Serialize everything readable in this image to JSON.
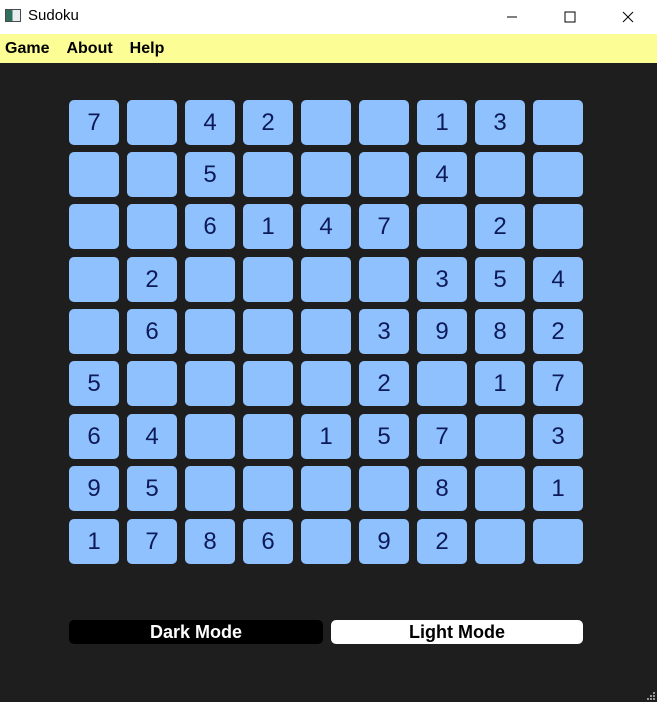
{
  "window": {
    "title": "Sudoku"
  },
  "menu": {
    "items": [
      "Game",
      "About",
      "Help"
    ]
  },
  "board": {
    "rows": [
      [
        "7",
        "",
        "4",
        "2",
        "",
        "",
        "1",
        "3",
        ""
      ],
      [
        "",
        "",
        "5",
        "",
        "",
        "",
        "4",
        "",
        ""
      ],
      [
        "",
        "",
        "6",
        "1",
        "4",
        "7",
        "",
        "2",
        ""
      ],
      [
        "",
        "2",
        "",
        "",
        "",
        "",
        "3",
        "5",
        "4"
      ],
      [
        "",
        "6",
        "",
        "",
        "",
        "3",
        "9",
        "8",
        "2"
      ],
      [
        "5",
        "",
        "",
        "",
        "",
        "2",
        "",
        "1",
        "7"
      ],
      [
        "6",
        "4",
        "",
        "",
        "1",
        "5",
        "7",
        "",
        "3"
      ],
      [
        "9",
        "5",
        "",
        "",
        "",
        "",
        "8",
        "",
        "1"
      ],
      [
        "1",
        "7",
        "8",
        "6",
        "",
        "9",
        "2",
        "",
        ""
      ]
    ]
  },
  "buttons": {
    "dark_mode": "Dark Mode",
    "light_mode": "Light Mode"
  },
  "colors": {
    "background": "#1e1e1e",
    "menubar": "#fdfd96",
    "cell": "#8fc1ff",
    "digit": "#0d1a57"
  },
  "icons": {
    "app": "app-window-icon",
    "minimize": "minimize-icon",
    "maximize": "maximize-icon",
    "close": "close-icon",
    "grip": "resize-grip-icon"
  }
}
